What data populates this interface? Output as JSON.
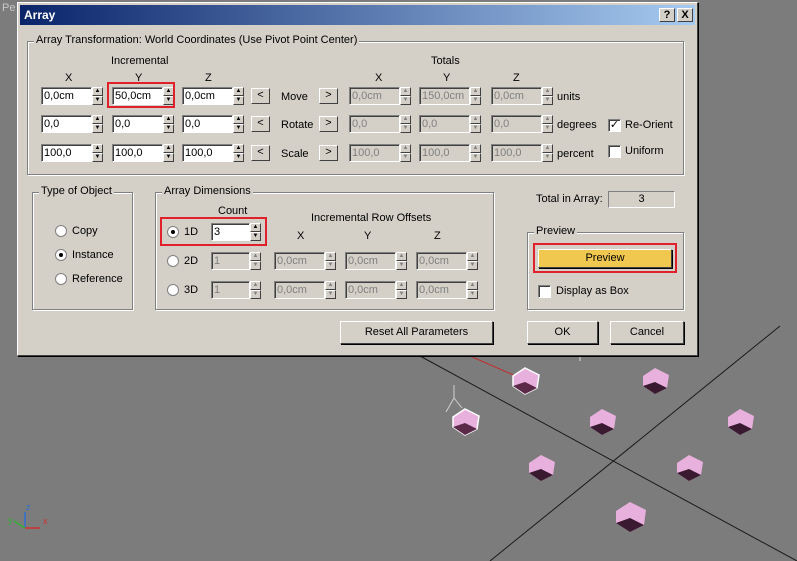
{
  "viewport": {
    "corner_label": "Pe",
    "axis_x": "x",
    "axis_y": "y",
    "axis_z": "z"
  },
  "dialog": {
    "title": "Array",
    "help_btn": "?",
    "close_btn": "X",
    "transform": {
      "caption": "Array Transformation: World Coordinates (Use Pivot Point Center)",
      "incremental": "Incremental",
      "totals": "Totals",
      "x": "X",
      "y": "Y",
      "z": "Z",
      "rows": [
        {
          "label": "Move",
          "inc": [
            "0,0cm",
            "50,0cm",
            "0,0cm"
          ],
          "tot": [
            "0,0cm",
            "150,0cm",
            "0,0cm"
          ],
          "unit": "units"
        },
        {
          "label": "Rotate",
          "inc": [
            "0,0",
            "0,0",
            "0,0"
          ],
          "tot": [
            "0,0",
            "0,0",
            "0,0"
          ],
          "unit": "degrees"
        },
        {
          "label": "Scale",
          "inc": [
            "100,0",
            "100,0",
            "100,0"
          ],
          "tot": [
            "100,0",
            "100,0",
            "100,0"
          ],
          "unit": "percent"
        }
      ],
      "left_arrow": "<",
      "right_arrow": ">",
      "reorient": "Re-Orient",
      "uniform": "Uniform"
    },
    "type_of_object": {
      "caption": "Type of Object",
      "copy": "Copy",
      "instance": "Instance",
      "reference": "Reference"
    },
    "dims": {
      "caption": "Array Dimensions",
      "count": "Count",
      "offsets": "Incremental Row Offsets",
      "x": "X",
      "y": "Y",
      "z": "Z",
      "d1": "1D",
      "d2": "2D",
      "d3": "3D",
      "count1": "3",
      "count2": "1",
      "count3": "1",
      "off2": [
        "0,0cm",
        "0,0cm",
        "0,0cm"
      ],
      "off3": [
        "0,0cm",
        "0,0cm",
        "0,0cm"
      ]
    },
    "total": {
      "label": "Total in Array:",
      "value": "3"
    },
    "preview": {
      "caption": "Preview",
      "button": "Preview",
      "display_as_box": "Display as Box"
    },
    "buttons": {
      "reset": "Reset All Parameters",
      "ok": "OK",
      "cancel": "Cancel"
    },
    "colors": {
      "highlight": "#e0202a",
      "preview_btn": "#f0c850",
      "title_start": "#0a246a",
      "title_end": "#a6caf0"
    }
  }
}
